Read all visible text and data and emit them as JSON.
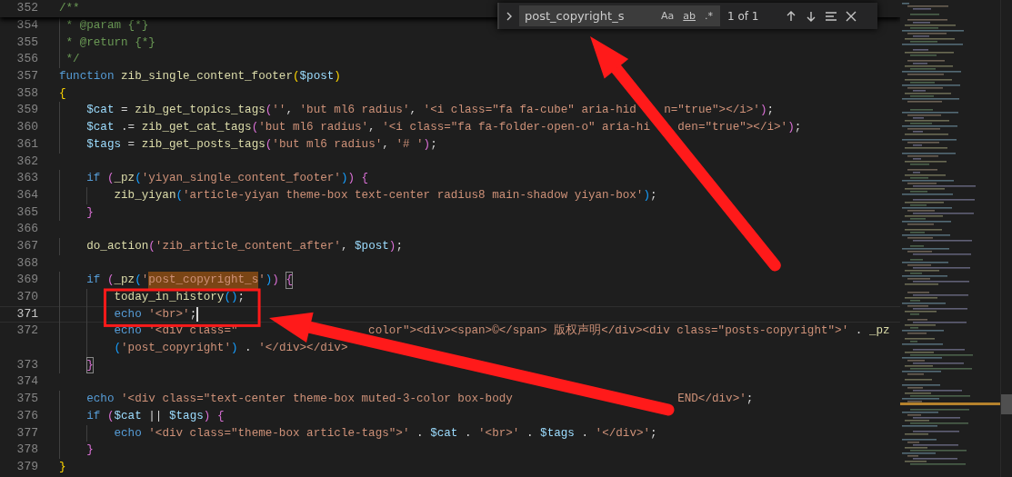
{
  "find_widget": {
    "query": "post_copyright_s",
    "options": [
      {
        "label": "Aa",
        "on": false
      },
      {
        "label": "ab",
        "on": false
      },
      {
        "label": ".*",
        "on": false
      }
    ],
    "match_count": "1 of 1"
  },
  "sticky_line": {
    "number": "352",
    "tokens": [
      {
        "kind": "cm",
        "text": "/**"
      }
    ]
  },
  "lines": [
    {
      "number": "354",
      "current": false,
      "tokens": [
        {
          "kind": "cm",
          "text": " * @param {*}"
        }
      ]
    },
    {
      "number": "355",
      "current": false,
      "tokens": [
        {
          "kind": "cm",
          "text": " * @return {*}"
        }
      ]
    },
    {
      "number": "356",
      "current": false,
      "tokens": [
        {
          "kind": "cm",
          "text": " */"
        }
      ]
    },
    {
      "number": "357",
      "current": false,
      "tokens": [
        {
          "kind": "kw",
          "text": "function "
        },
        {
          "kind": "fn",
          "text": "zib_single_content_footer"
        },
        {
          "kind": "b1",
          "text": "("
        },
        {
          "kind": "var",
          "text": "$post"
        },
        {
          "kind": "b1",
          "text": ")"
        }
      ]
    },
    {
      "number": "358",
      "current": false,
      "tokens": [
        {
          "kind": "b1",
          "text": "{"
        }
      ]
    },
    {
      "number": "359",
      "current": false,
      "tokens": [
        {
          "kind": "var",
          "text": "    $cat"
        },
        {
          "kind": "p",
          "text": " = "
        },
        {
          "kind": "fn",
          "text": "zib_get_topics_tags"
        },
        {
          "kind": "b2",
          "text": "("
        },
        {
          "kind": "str",
          "text": "''"
        },
        {
          "kind": "p",
          "text": ", "
        },
        {
          "kind": "str",
          "text": "'but ml6 radius'"
        },
        {
          "kind": "p",
          "text": ", "
        },
        {
          "kind": "str",
          "text": "'<i class=\"fa fa-cube\" aria-hid"
        },
        {
          "kind": "str",
          "text": "n=\"true\"></i>'",
          "gap_before": true
        },
        {
          "kind": "b2",
          "text": ")"
        },
        {
          "kind": "p",
          "text": ";"
        }
      ]
    },
    {
      "number": "360",
      "current": false,
      "tokens": [
        {
          "kind": "var",
          "text": "    $cat"
        },
        {
          "kind": "p",
          "text": " .= "
        },
        {
          "kind": "fn",
          "text": "zib_get_cat_tags"
        },
        {
          "kind": "b2",
          "text": "("
        },
        {
          "kind": "str",
          "text": "'but ml6 radius'"
        },
        {
          "kind": "p",
          "text": ", "
        },
        {
          "kind": "str",
          "text": "'<i class=\"fa fa-folder-open-o\" aria-hi"
        },
        {
          "kind": "str",
          "text": "den=\"true\"></i>'",
          "gap_before": true
        },
        {
          "kind": "b2",
          "text": ")"
        },
        {
          "kind": "p",
          "text": ";"
        }
      ]
    },
    {
      "number": "361",
      "current": false,
      "tokens": [
        {
          "kind": "var",
          "text": "    $tags"
        },
        {
          "kind": "p",
          "text": " = "
        },
        {
          "kind": "fn",
          "text": "zib_get_posts_tags"
        },
        {
          "kind": "b2",
          "text": "("
        },
        {
          "kind": "str",
          "text": "'but ml6 radius'"
        },
        {
          "kind": "p",
          "text": ", "
        },
        {
          "kind": "str",
          "text": "'# '"
        },
        {
          "kind": "b2",
          "text": ")"
        },
        {
          "kind": "p",
          "text": ";"
        }
      ]
    },
    {
      "number": "362",
      "current": false
    },
    {
      "number": "363",
      "current": false,
      "tokens": [
        {
          "kind": "kw",
          "text": "    if "
        },
        {
          "kind": "b2",
          "text": "("
        },
        {
          "kind": "fn",
          "text": "_pz"
        },
        {
          "kind": "b3",
          "text": "("
        },
        {
          "kind": "str",
          "text": "'yiyan_single_content_footer'"
        },
        {
          "kind": "b3",
          "text": ")"
        },
        {
          "kind": "b2",
          "text": ") "
        },
        {
          "kind": "b2",
          "text": "{"
        }
      ]
    },
    {
      "number": "364",
      "current": false,
      "tokens": [
        {
          "kind": "fn",
          "text": "        zib_yiyan"
        },
        {
          "kind": "b3",
          "text": "("
        },
        {
          "kind": "str",
          "text": "'article-yiyan theme-box text-center radius8 main-shadow yiyan-box'"
        },
        {
          "kind": "b3",
          "text": ")"
        },
        {
          "kind": "p",
          "text": ";"
        }
      ]
    },
    {
      "number": "365",
      "current": false,
      "tokens": [
        {
          "kind": "b2",
          "text": "    }"
        }
      ]
    },
    {
      "number": "366",
      "current": false
    },
    {
      "number": "367",
      "current": false,
      "tokens": [
        {
          "kind": "fn",
          "text": "    do_action"
        },
        {
          "kind": "b2",
          "text": "("
        },
        {
          "kind": "str",
          "text": "'zib_article_content_after'"
        },
        {
          "kind": "p",
          "text": ", "
        },
        {
          "kind": "var",
          "text": "$post"
        },
        {
          "kind": "b2",
          "text": ")"
        },
        {
          "kind": "p",
          "text": ";"
        }
      ]
    },
    {
      "number": "368",
      "current": false
    },
    {
      "number": "369",
      "current": false,
      "tokens": [
        {
          "kind": "kw",
          "text": "    if "
        },
        {
          "kind": "b2",
          "text": "("
        },
        {
          "kind": "fn",
          "text": "_pz"
        },
        {
          "kind": "b3",
          "text": "("
        },
        {
          "kind": "str",
          "text": "'"
        },
        {
          "kind": "str",
          "text": "post_copyright_s",
          "match": true
        },
        {
          "kind": "str",
          "text": "'"
        },
        {
          "kind": "b3",
          "text": ")"
        },
        {
          "kind": "b2",
          "text": ") "
        },
        {
          "kind": "b2",
          "text": "{",
          "bracket_match": true
        }
      ]
    },
    {
      "number": "370",
      "current": false,
      "tokens": [
        {
          "kind": "fn",
          "text": "        today_in_history"
        },
        {
          "kind": "b3",
          "text": "()"
        },
        {
          "kind": "p",
          "text": ";"
        }
      ]
    },
    {
      "number": "371",
      "current": true,
      "tokens": [
        {
          "kind": "kw",
          "text": "        echo "
        },
        {
          "kind": "str",
          "text": "'<br>'"
        },
        {
          "kind": "p",
          "text": ";"
        }
      ]
    },
    {
      "number": "372",
      "current": false,
      "tokens": [
        {
          "kind": "kw",
          "text": "        echo "
        },
        {
          "kind": "str",
          "text": "'<div class=\""
        },
        {
          "kind": "str",
          "text": "color\"><div><span>©</span> 版权声明</div><div class=\"posts-copyright\">'",
          "gap_before": true
        },
        {
          "kind": "p",
          "text": " . "
        },
        {
          "kind": "fn",
          "text": "_pz"
        }
      ]
    },
    {
      "current": false,
      "tokens": [
        {
          "kind": "b3",
          "text": "        ("
        },
        {
          "kind": "str",
          "text": "'post_copyright'"
        },
        {
          "kind": "b3",
          "text": ")"
        },
        {
          "kind": "p",
          "text": " . "
        },
        {
          "kind": "str",
          "text": "'</div></div>"
        }
      ]
    },
    {
      "number": "373",
      "current": false,
      "tokens": [
        {
          "kind": "b2",
          "text": "    }",
          "bracket_match": true
        }
      ]
    },
    {
      "number": "374",
      "current": false
    },
    {
      "number": "375",
      "current": false,
      "tokens": [
        {
          "kind": "kw",
          "text": "    echo "
        },
        {
          "kind": "str",
          "text": "'<div class=\"text-center theme-box muted-3-color box-body"
        },
        {
          "kind": "str",
          "text": "END</div>'",
          "gap_before": true
        },
        {
          "kind": "p",
          "text": ";"
        }
      ]
    },
    {
      "number": "376",
      "current": false,
      "tokens": [
        {
          "kind": "kw",
          "text": "    if "
        },
        {
          "kind": "b2",
          "text": "("
        },
        {
          "kind": "var",
          "text": "$cat"
        },
        {
          "kind": "p",
          "text": " || "
        },
        {
          "kind": "var",
          "text": "$tags"
        },
        {
          "kind": "b2",
          "text": ") "
        },
        {
          "kind": "b2",
          "text": "{"
        }
      ]
    },
    {
      "number": "377",
      "current": false,
      "tokens": [
        {
          "kind": "kw",
          "text": "        echo "
        },
        {
          "kind": "str",
          "text": "'<div class=\"theme-box article-tags\">'"
        },
        {
          "kind": "p",
          "text": " . "
        },
        {
          "kind": "var",
          "text": "$cat"
        },
        {
          "kind": "p",
          "text": " . "
        },
        {
          "kind": "str",
          "text": "'<br>'"
        },
        {
          "kind": "p",
          "text": " . "
        },
        {
          "kind": "var",
          "text": "$tags"
        },
        {
          "kind": "p",
          "text": " . "
        },
        {
          "kind": "str",
          "text": "'</div>'"
        },
        {
          "kind": "p",
          "text": ";"
        }
      ]
    },
    {
      "number": "378",
      "current": false,
      "tokens": [
        {
          "kind": "b2",
          "text": "    }"
        }
      ]
    },
    {
      "number": "379",
      "current": false,
      "tokens": [
        {
          "kind": "b1",
          "text": "}"
        }
      ]
    }
  ],
  "annotations": [
    {
      "kind": "box"
    },
    {
      "kind": "arrow"
    },
    {
      "kind": "arrow"
    }
  ]
}
